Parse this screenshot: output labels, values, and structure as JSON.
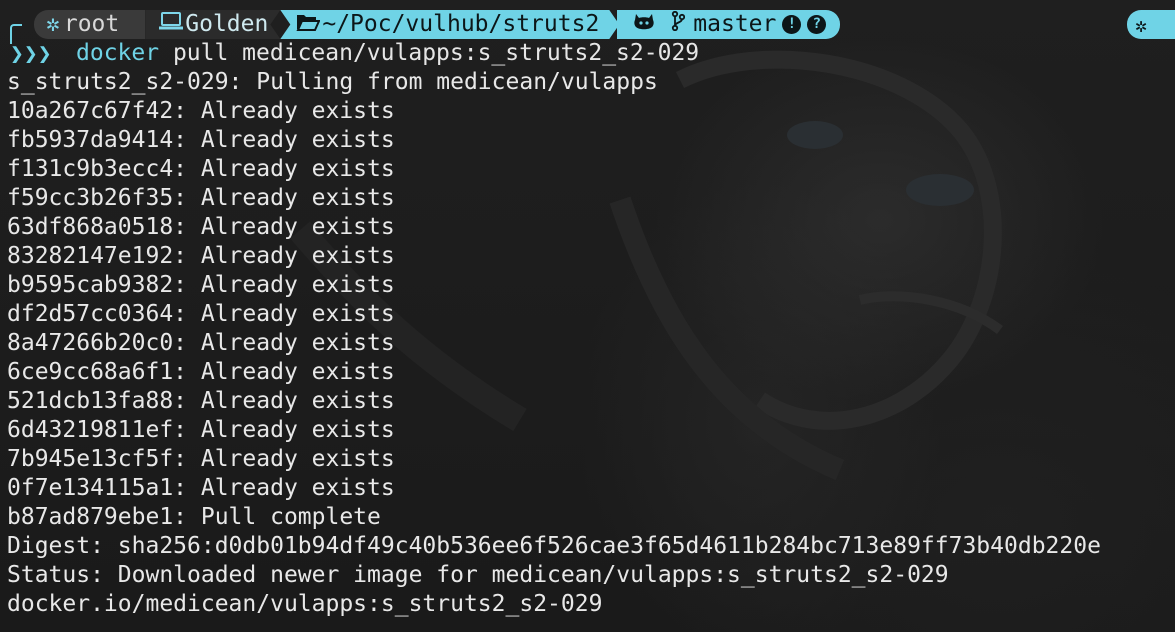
{
  "prompt": {
    "user_icon": "gear-icon",
    "user": "root",
    "host_icon": "laptop-icon",
    "host": "Golden",
    "path_icon": "folder-open-icon",
    "path": "~/Poc/vulhub/struts2",
    "git_icon": "github-icon",
    "branch_icon": "git-branch-icon",
    "branch": "master",
    "status_icons": [
      "exclamation-circle-icon",
      "question-circle-icon"
    ],
    "arrow": "❯❯❯",
    "accent_color": "#6fd3e6"
  },
  "command": {
    "program": "docker",
    "args": " pull medicean/vulapps:s_struts2_s2-029"
  },
  "output": [
    "s_struts2_s2-029: Pulling from medicean/vulapps",
    "10a267c67f42: Already exists",
    "fb5937da9414: Already exists",
    "f131c9b3ecc4: Already exists",
    "f59cc3b26f35: Already exists",
    "63df868a0518: Already exists",
    "83282147e192: Already exists",
    "b9595cab9382: Already exists",
    "df2d57cc0364: Already exists",
    "8a47266b20c0: Already exists",
    "6ce9cc68a6f1: Already exists",
    "521dcb13fa88: Already exists",
    "6d43219811ef: Already exists",
    "7b945e13cf5f: Already exists",
    "0f7e134115a1: Already exists",
    "b87ad879ebe1: Pull complete",
    "Digest: sha256:d0db01b94df49c40b536ee6f526cae3f65d4611b284bc713e89ff73b40db220e",
    "Status: Downloaded newer image for medicean/vulapps:s_struts2_s2-029",
    "docker.io/medicean/vulapps:s_struts2_s2-029"
  ]
}
